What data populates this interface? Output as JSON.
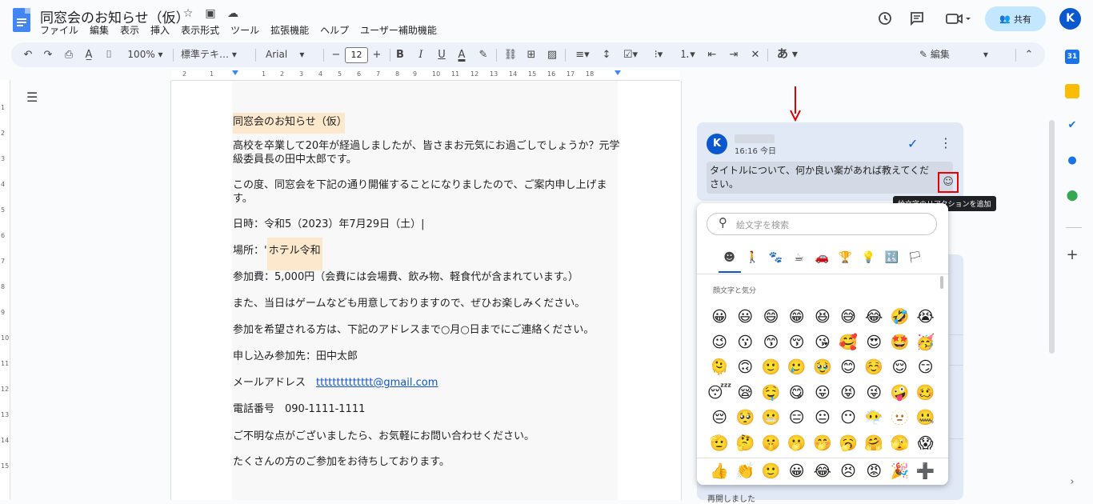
{
  "app": {
    "doc_title": "同窓会のお知らせ（仮）",
    "menus": [
      "ファイル",
      "編集",
      "表示",
      "挿入",
      "表示形式",
      "ツール",
      "拡張機能",
      "ヘルプ",
      "ユーザー補助機能"
    ],
    "share_label": "共有",
    "avatar_letter": "K"
  },
  "toolbar": {
    "zoom": "100%",
    "style": "標準テキ…",
    "font": "Arial",
    "font_size": "12",
    "text_lang_glyph": "あ",
    "mode": "編集"
  },
  "ruler": {
    "h_ticks": [
      "2",
      "1",
      "1",
      "2",
      "3",
      "4",
      "5",
      "6",
      "7",
      "8",
      "9",
      "10",
      "11",
      "12",
      "13",
      "14",
      "15",
      "16",
      "17",
      "18"
    ],
    "v_ticks": [
      "1",
      "2",
      "3",
      "4",
      "5",
      "6",
      "7",
      "8",
      "9",
      "10",
      "11",
      "12",
      "13",
      "14",
      "15"
    ]
  },
  "document": {
    "title_line": "同窓会のお知らせ（仮）",
    "p1_line1": "高校を卒業して20年が経過しましたが、皆さまお元気にお過ごしでしょうか？元学",
    "p1_line2": "級委員長の田中太郎です。",
    "p2_line1": "この度、同窓会を下記の通り開催することになりましたので、ご案内申し上げま",
    "p2_line2": "す。",
    "date_line": "日時：令和5（2023）年7月29日（土）|",
    "place_prefix": " 場所：'",
    "place_value": "ホテル令和",
    "fee_line": " 参加費：5,000円（会費には会場費、飲み物、軽食代が含まれています。）",
    "game_line": "また、当日はゲームなども用意しておりますので、ぜひお楽しみください。",
    "rsvp_line": "参加を希望される方は、下記のアドレスまで○月○日までにご連絡ください。",
    "contact_line": "申し込み参加先：田中太郎",
    "email_label": "メールアドレス　",
    "email_value": "tttttttttttttt@gmail.com",
    "phone_line": "電話番号　090-1111-1111",
    "question_line": "ご不明な点がございましたら、お気軽にお問い合わせください。",
    "closing_line": "たくさんの方のご参加をお待ちしております。"
  },
  "comment": {
    "avatar_letter": "K",
    "time": "16:16 今日",
    "text": "タイトルについて、何か良い案があれば教えてください。",
    "tooltip": "絵文字のリアクションを追加",
    "reopen_text": "再開しました"
  },
  "emoji_picker": {
    "search_placeholder": "絵文字を検索",
    "category_label": "顔文字と気分",
    "categories": [
      "☻",
      "🚶",
      "🐾",
      "☕",
      "🚗",
      "🏆",
      "💡",
      "🔣",
      "🏳"
    ],
    "emojis": [
      "😀",
      "😃",
      "😄",
      "😁",
      "😆",
      "😅",
      "😂",
      "🤣",
      "😭",
      "😉",
      "😗",
      "😙",
      "😚",
      "😘",
      "🥰",
      "😍",
      "🤩",
      "🥳",
      "🫠",
      "🙃",
      "🙂",
      "🥲",
      "🥹",
      "😊",
      "☺️",
      "😌",
      "😏",
      "😴",
      "😪",
      "🤤",
      "😋",
      "😛",
      "😝",
      "😜",
      "🤪",
      "🥴",
      "😔",
      "🥺",
      "😬",
      "😑",
      "😐",
      "😶",
      "😶‍🌫️",
      "🫥",
      "🤐",
      "🫡",
      "🤔",
      "🤫",
      "🫢",
      "🤭",
      "🥱",
      "🤗",
      "🫣",
      "😱"
    ],
    "quick_reactions": [
      "👍",
      "👏",
      "🙂",
      "😀",
      "😂",
      "😣",
      "😡",
      "🎉",
      "➕"
    ]
  },
  "colors": {
    "accent": "#0b57d0",
    "highlight": "#fce8cc",
    "red_marker": "#e00000"
  }
}
